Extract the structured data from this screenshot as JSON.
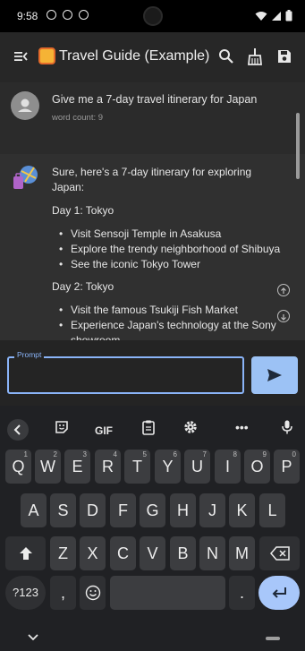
{
  "status_bar": {
    "time": "9:58"
  },
  "app_bar": {
    "title": "Travel Guide (Example)"
  },
  "chat": {
    "user_message": {
      "text": "Give me a 7-day travel itinerary for Japan",
      "word_count": "word count: 9"
    },
    "bot_message": {
      "intro": "Sure, here's a 7-day itinerary for exploring Japan:",
      "days": [
        {
          "title": "Day 1: Tokyo",
          "items": [
            "Visit Sensoji Temple in Asakusa",
            "Explore the trendy neighborhood of Shibuya",
            "See the iconic Tokyo Tower"
          ]
        },
        {
          "title": "Day 2: Tokyo",
          "items": [
            "Visit the famous Tsukiji Fish Market",
            "Experience Japan's technology at the Sony showroom"
          ]
        }
      ]
    }
  },
  "input": {
    "label": "Prompt",
    "value": ""
  },
  "keyboard": {
    "toolbar": {
      "gif": "GIF",
      "more": "•••"
    },
    "row1": [
      {
        "k": "Q",
        "s": "1"
      },
      {
        "k": "W",
        "s": "2"
      },
      {
        "k": "E",
        "s": "3"
      },
      {
        "k": "R",
        "s": "4"
      },
      {
        "k": "T",
        "s": "5"
      },
      {
        "k": "Y",
        "s": "6"
      },
      {
        "k": "U",
        "s": "7"
      },
      {
        "k": "I",
        "s": "8"
      },
      {
        "k": "O",
        "s": "9"
      },
      {
        "k": "P",
        "s": "0"
      }
    ],
    "row2": [
      "A",
      "S",
      "D",
      "F",
      "G",
      "H",
      "J",
      "K",
      "L"
    ],
    "row3": [
      "Z",
      "X",
      "C",
      "V",
      "B",
      "N",
      "M"
    ],
    "symbols": "?123",
    "comma": ",",
    "period": "."
  }
}
